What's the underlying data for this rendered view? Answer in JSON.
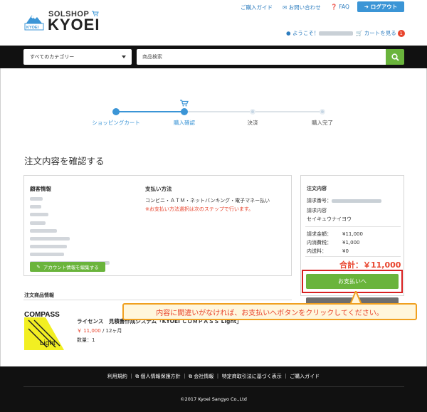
{
  "brand": {
    "logo_top": "SOLSHOP",
    "logo_main": "KYOEI",
    "logo_mark_text": "KYOEI"
  },
  "toplinks": {
    "guide": "ご購入ガイド",
    "contact": "お問い合わせ",
    "faq": "FAQ",
    "logout": "ログアウト"
  },
  "header": {
    "welcome": "ようこそ！",
    "cart": "カートを見る",
    "cart_count": "1"
  },
  "search": {
    "category": "すべてのカテゴリー",
    "placeholder": "商品検索"
  },
  "steps": [
    {
      "label": "ショッピングカート",
      "state": "done"
    },
    {
      "label": "購入確認",
      "state": "current"
    },
    {
      "label": "決済",
      "state": "todo"
    },
    {
      "label": "購入完了",
      "state": "todo"
    }
  ],
  "page_title": "注文内容を確認する",
  "customer": {
    "heading": "顧客情報",
    "edit_button": "アカウント情報を編集する"
  },
  "payment": {
    "heading": "支払い方法",
    "method": "コンビニ・ＡＴＭ・ネットバンキング・電子マネー払い",
    "note": "※お支払い方法選択は次のステップで行います。"
  },
  "order": {
    "heading": "注文内容",
    "number_label": "請求番号：",
    "content_label": "請求内容",
    "content_value": "セイキュウナイヨウ",
    "amount_label": "請求金額：",
    "amount_value": "¥11,000",
    "tax_label": "内消費税：",
    "tax_value": "¥1,000",
    "shipping_label": "内送料：",
    "shipping_value": "¥0",
    "total": "合計：￥11,000",
    "pay_button": "お支払いへ"
  },
  "products": {
    "heading": "注文商品情報",
    "items": [
      {
        "name": "ライセンス　見積書作成システム「KYOEI ＣＯＭＰＡＳＳ Light」",
        "price": "￥ 11,000",
        "period": " / 12ヶ月",
        "qty": "数量：1",
        "image_title": "COMPASS",
        "image_sub": "Light"
      }
    ]
  },
  "callout": "内容に間違いがなければ、お支払いへボタンをクリックしてください。",
  "footer": {
    "links": [
      "利用規約",
      "個人情報保護方針",
      "会社情報",
      "特定商取引法に基づく表示",
      "ご購入ガイド"
    ],
    "copyright": "©2017 Kyoei Sangyo Co.,Ltd"
  },
  "colors": {
    "accent_green": "#6ab43c",
    "link_blue": "#2d7dbf",
    "alert_red": "#e8432c",
    "step_blue": "#3b95d6"
  }
}
